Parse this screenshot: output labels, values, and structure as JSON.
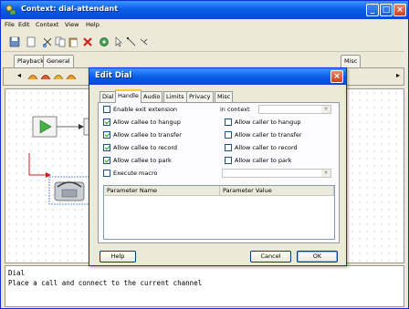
{
  "window": {
    "title": "Context: dial-attendant"
  },
  "menu": [
    "File",
    "Edit",
    "Context",
    "View",
    "Help"
  ],
  "palette": {
    "tabs": [
      "Playback",
      "General"
    ],
    "extra_tabs": [
      "Misc"
    ]
  },
  "canvas": {
    "nodes": [
      "start-node",
      "node-2",
      "phone-node"
    ]
  },
  "dialog": {
    "title": "Edit Dial",
    "tabs": [
      "Dial",
      "Handle",
      "Audio",
      "Limits",
      "Privacy",
      "Misc"
    ],
    "active_tab": "Handle",
    "enable_extension": {
      "label": "Enable exit extension",
      "checked": false
    },
    "in_context_label": "in context",
    "in_context_value": "",
    "left_options": [
      {
        "label": "Allow callee to hangup",
        "checked": true
      },
      {
        "label": "Allow callee to transfer",
        "checked": true
      },
      {
        "label": "Allow callee to record",
        "checked": true
      },
      {
        "label": "Allow callee to park",
        "checked": true
      }
    ],
    "right_options": [
      {
        "label": "Allow caller to hangup",
        "checked": false
      },
      {
        "label": "Allow caller to transfer",
        "checked": false
      },
      {
        "label": "Allow caller to record",
        "checked": false
      },
      {
        "label": "Allow caller to park",
        "checked": false
      }
    ],
    "execute_macro": {
      "label": "Execute macro",
      "checked": false
    },
    "macro_value": "",
    "table": {
      "columns": [
        "Parameter Name",
        "Parameter Value"
      ],
      "rows": []
    },
    "buttons": {
      "help": "Help",
      "cancel": "Cancel",
      "ok": "OK"
    }
  },
  "description": {
    "line1": "Dial",
    "line2": "Place a call and connect to the current channel"
  },
  "colors": {
    "titlebar": "#0a5fe6",
    "accent_tab": "#ffc83c",
    "check": "#21a121"
  }
}
